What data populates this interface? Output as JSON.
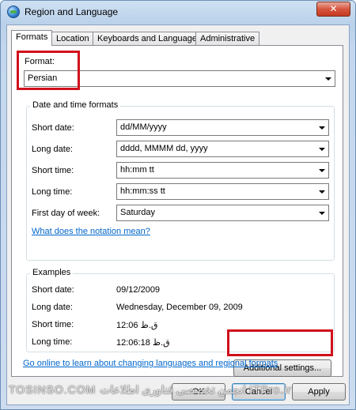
{
  "window": {
    "title": "Region and Language",
    "close_glyph": "✕"
  },
  "tabs": [
    {
      "label": "Formats",
      "active": true
    },
    {
      "label": "Location"
    },
    {
      "label": "Keyboards and Languages"
    },
    {
      "label": "Administrative"
    }
  ],
  "format": {
    "label": "Format:",
    "value": "Persian"
  },
  "datetime": {
    "title": "Date and time formats",
    "short_date": {
      "label": "Short date:",
      "value": "dd/MM/yyyy"
    },
    "long_date": {
      "label": "Long date:",
      "value": "dddd, MMMM dd, yyyy"
    },
    "short_time": {
      "label": "Short time:",
      "value": "hh:mm tt"
    },
    "long_time": {
      "label": "Long time:",
      "value": "hh:mm:ss tt"
    },
    "first_day": {
      "label": "First day of week:",
      "value": "Saturday"
    },
    "notation_link": "What does the notation mean?"
  },
  "examples": {
    "title": "Examples",
    "short_date": {
      "label": "Short date:",
      "value": "09/12/2009"
    },
    "long_date": {
      "label": "Long date:",
      "value": "Wednesday, December 09, 2009"
    },
    "short_time": {
      "label": "Short time:",
      "value": "12:06 ق.ظ"
    },
    "long_time": {
      "label": "Long time:",
      "value": "12:06:18 ق.ظ"
    }
  },
  "additional_settings": "Additional settings...",
  "online_link": "Go online to learn about changing languages and regional formats",
  "buttons": {
    "ok": "OK",
    "cancel": "Cancel",
    "apply": "Apply"
  },
  "watermark": "TOSINSO.COM     انجمن تخصصی فناوری اطلاعات ITPro.ir",
  "colors": {
    "highlight": "#d0101c",
    "link": "#0066cc"
  }
}
